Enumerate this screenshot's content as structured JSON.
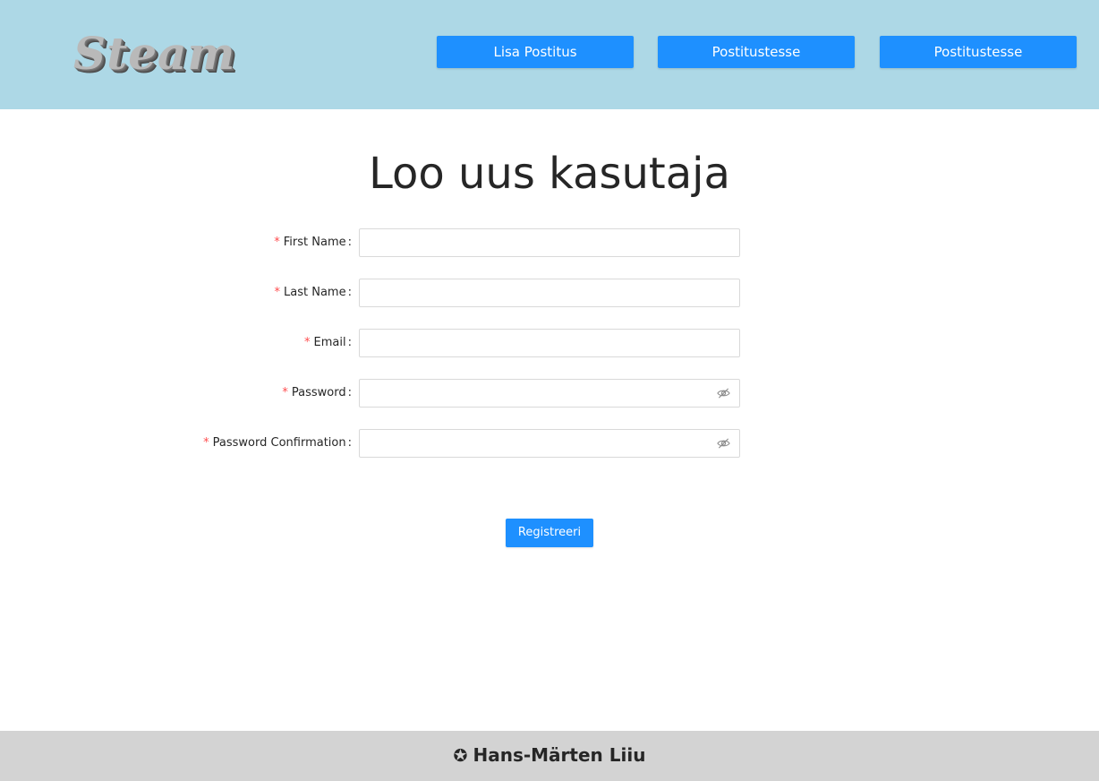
{
  "header": {
    "logo_text": "Steam",
    "background": "#add8e6",
    "nav": [
      {
        "label": "Lisa Postitus"
      },
      {
        "label": "Postitustesse"
      },
      {
        "label": "Postitustesse"
      }
    ],
    "accent": "#1e90ff"
  },
  "main": {
    "title": "Loo uus kasutaja",
    "form": {
      "fields": [
        {
          "label": "First Name",
          "value": "",
          "type": "text",
          "required": true
        },
        {
          "label": "Last Name",
          "value": "",
          "type": "text",
          "required": true
        },
        {
          "label": "Email",
          "value": "",
          "type": "text",
          "required": true
        },
        {
          "label": "Password",
          "value": "",
          "type": "password",
          "required": true,
          "icon": "eye-invisible-icon"
        },
        {
          "label": "Password Confirmation",
          "value": "",
          "type": "password",
          "required": true,
          "icon": "eye-invisible-icon"
        }
      ],
      "required_mark": "*",
      "label_suffix": ":",
      "submit_label": "Registreeri"
    }
  },
  "footer": {
    "icon": "star-icon",
    "icon_glyph": "✪",
    "text": "Hans-Märten Liiu",
    "background": "#d3d3d3"
  }
}
